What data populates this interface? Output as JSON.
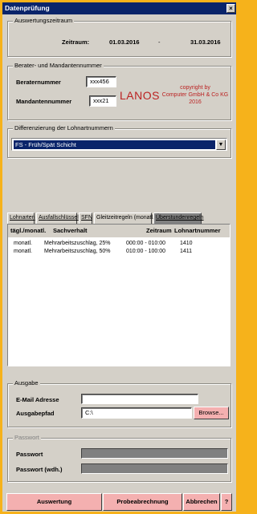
{
  "window": {
    "title": "Datenprüfung",
    "close_label": "×"
  },
  "auswertungszeitraum": {
    "legend": "Auswertungszeitraum",
    "zeitraum_label": "Zeitraum:",
    "from": "01.03.2016",
    "separator": "-",
    "to": "31.03.2016"
  },
  "berater": {
    "legend": "Berater- und Mandantennummer",
    "berater_label": "Beraternummer",
    "berater_value": "xxx456",
    "mandant_label": "Mandantennummer",
    "mandant_value": "xxx21",
    "logo_name": "LANOS",
    "copyright_line1": "copyright by",
    "copyright_line2": "Computer GmbH & Co KG",
    "copyright_year": "2016"
  },
  "differenzierung": {
    "legend": "Differenzierung der Lohnartnummern",
    "selected": "FS - Früh/Spät Schicht",
    "arrow": "▼"
  },
  "tabs": [
    {
      "label": "Lohnarten"
    },
    {
      "label": "Ausfallschlüssel"
    },
    {
      "label": "SFN"
    },
    {
      "label": "Gleitzeitregeln (monatl.)"
    },
    {
      "label": "Überstundenregeln"
    }
  ],
  "table": {
    "columns": [
      "tägl./monatl.",
      "Sachverhalt",
      "Zeitraum",
      "Lohnartnummer"
    ],
    "rows": [
      {
        "typ": "monatl.",
        "sachverhalt": "Mehrarbeitszuschlag, 25%",
        "zeitraum": "000:00 - 010:00",
        "lohnart": "1410"
      },
      {
        "typ": "monatl.",
        "sachverhalt": "Mehrarbeitszuschlag, 50%",
        "zeitraum": "010:00 - 100:00",
        "lohnart": "1411"
      }
    ]
  },
  "ausgabe": {
    "legend": "Ausgabe",
    "email_label": "E-Mail Adresse",
    "email_value": "",
    "pfad_label": "Ausgabepfad",
    "pfad_value": "C:\\",
    "browse_label": "Browse..."
  },
  "passwort": {
    "legend": "Passwort",
    "pw_label": "Passwort",
    "pw2_label": "Passwort (wdh.)"
  },
  "buttons": {
    "auswertung": "Auswertung",
    "probe": "Probeabrechnung",
    "abbrechen": "Abbrechen",
    "help": "?"
  },
  "colors": {
    "background": "#f6b21b",
    "titlebar": "#0a246a",
    "action_buttons": "#f4b0b0",
    "logo": "#b22222"
  }
}
